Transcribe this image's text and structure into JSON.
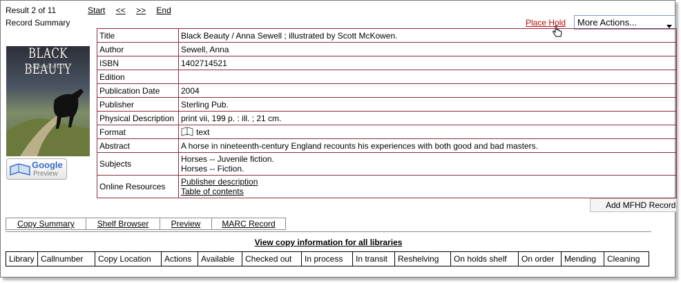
{
  "header": {
    "result_count": "Result 2 of 11",
    "record_summary": "Record Summary",
    "nav": [
      "Start",
      "<<",
      ">>",
      "End"
    ]
  },
  "actions": {
    "place_hold": "Place Hold",
    "more_actions": "More Actions..."
  },
  "cover": {
    "title": "BLACK BEAUTY",
    "author": "ANNA SEWELL"
  },
  "google_preview": {
    "line1": "Google",
    "line2": "Preview"
  },
  "details": [
    {
      "label": "Title",
      "value": "Black Beauty / Anna Sewell ; illustrated by Scott McKowen."
    },
    {
      "label": "Author",
      "value": "Sewell, Anna"
    },
    {
      "label": "ISBN",
      "value": "1402714521"
    },
    {
      "label": "Edition",
      "value": ""
    },
    {
      "label": "Publication Date",
      "value": "2004"
    },
    {
      "label": "Publisher",
      "value": "Sterling Pub."
    },
    {
      "label": "Physical Description",
      "value": "print vii, 199 p. : ill. ; 21 cm."
    },
    {
      "label": "Format",
      "value": "text"
    },
    {
      "label": "Abstract",
      "value": "A horse in nineteenth-century England recounts his experiences with both good and bad masters."
    },
    {
      "label": "Subjects",
      "values": [
        "Horses -- Juvenile fiction.",
        "Horses -- Fiction."
      ]
    },
    {
      "label": "Online Resources",
      "links": [
        "Publisher description",
        "Table of contents"
      ]
    }
  ],
  "add_mfhd": "Add MFHD Record",
  "tabs": [
    "Copy Summary",
    "Shelf Browser",
    "Preview",
    "MARC Record"
  ],
  "copies": {
    "view_all": "View copy information for all libraries",
    "columns": [
      "Library",
      "Callnumber",
      "Copy Location",
      "Actions",
      "Available",
      "Checked out",
      "In process",
      "In transit",
      "Reshelving",
      "On holds shelf",
      "On order",
      "Mending",
      "Cleaning"
    ]
  }
}
